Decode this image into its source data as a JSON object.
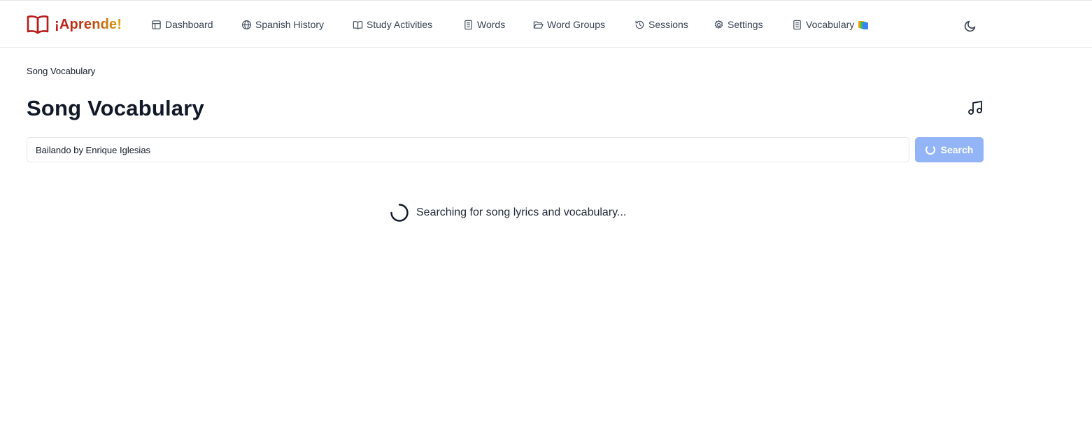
{
  "brand": {
    "name": "¡Aprende!",
    "icon": "open-book-icon",
    "color": "#b91c1c"
  },
  "nav": {
    "items": [
      {
        "label": "Dashboard",
        "icon": "layout-icon"
      },
      {
        "label": "Spanish History",
        "icon": "globe-icon"
      },
      {
        "label": "Study Activities",
        "icon": "book-open-icon"
      },
      {
        "label": "Words",
        "icon": "document-icon"
      },
      {
        "label": "Word Groups",
        "icon": "folder-open-icon"
      },
      {
        "label": "Sessions",
        "icon": "history-icon"
      },
      {
        "label": "Settings",
        "icon": "gear-icon"
      },
      {
        "label": "Vocabulary",
        "icon": "document-icon",
        "badge_icon": "books-emoji-icon"
      }
    ],
    "theme_toggle_icon": "moon-icon"
  },
  "breadcrumb": "Song Vocabulary",
  "page": {
    "title": "Song Vocabulary",
    "icon": "music-note-icon"
  },
  "search": {
    "value": "Bailando by Enrique Iglesias",
    "button_label": "Search",
    "button_color": "#93b4f6",
    "button_state": "loading"
  },
  "status": {
    "loading_text": "Searching for song lyrics and vocabulary..."
  }
}
